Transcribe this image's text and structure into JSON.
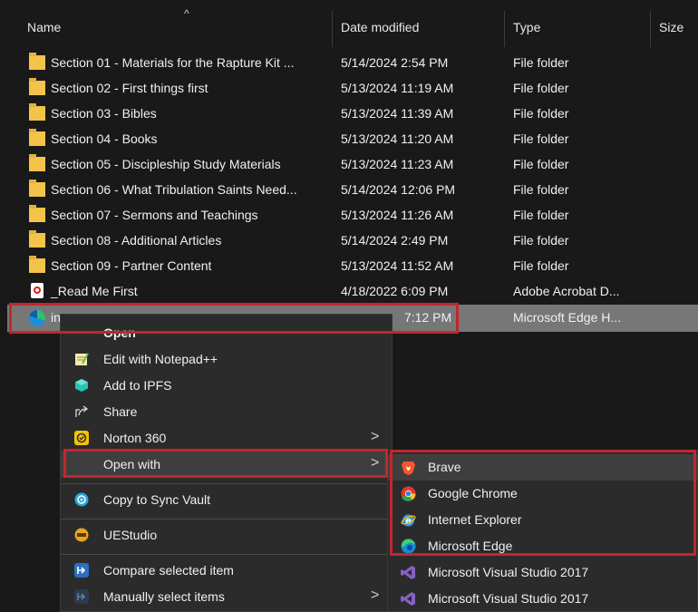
{
  "columns": {
    "name": "Name",
    "date": "Date modified",
    "type": "Type",
    "size": "Size"
  },
  "files": [
    {
      "name": "Section 01 - Materials for the Rapture Kit ...",
      "date": "5/14/2024 2:54 PM",
      "type": "File folder",
      "icon": "folder-icon"
    },
    {
      "name": "Section 02 - First things first",
      "date": "5/13/2024 11:19 AM",
      "type": "File folder",
      "icon": "folder-icon"
    },
    {
      "name": "Section 03 - Bibles",
      "date": "5/13/2024 11:39 AM",
      "type": "File folder",
      "icon": "folder-icon"
    },
    {
      "name": "Section 04 - Books",
      "date": "5/13/2024 11:20 AM",
      "type": "File folder",
      "icon": "folder-icon"
    },
    {
      "name": "Section 05 - Discipleship Study Materials",
      "date": "5/13/2024 11:23 AM",
      "type": "File folder",
      "icon": "folder-icon"
    },
    {
      "name": "Section 06 - What Tribulation Saints Need...",
      "date": "5/14/2024 12:06 PM",
      "type": "File folder",
      "icon": "folder-icon"
    },
    {
      "name": "Section 07 - Sermons and Teachings",
      "date": "5/13/2024 11:26 AM",
      "type": "File folder",
      "icon": "folder-icon"
    },
    {
      "name": "Section 08 - Additional Articles",
      "date": "5/14/2024 2:49 PM",
      "type": "File folder",
      "icon": "folder-icon"
    },
    {
      "name": "Section 09 - Partner Content",
      "date": "5/13/2024 11:52 AM",
      "type": "File folder",
      "icon": "folder-icon"
    },
    {
      "name": "_Read Me First",
      "date": "4/18/2022 6:09 PM",
      "type": "Adobe Acrobat D...",
      "icon": "pdf-icon"
    },
    {
      "name": "in",
      "date": "7:12 PM",
      "type": "Microsoft Edge H...",
      "icon": "edge-icon"
    }
  ],
  "context_menu": {
    "items": [
      {
        "label": "Open",
        "icon": "none"
      },
      {
        "label": "Edit with Notepad++",
        "icon": "notepad-icon"
      },
      {
        "label": "Add to IPFS",
        "icon": "ipfs-cube-icon"
      },
      {
        "label": "Share",
        "icon": "share-icon"
      },
      {
        "label": "Norton 360",
        "icon": "norton-icon"
      },
      {
        "label": "Open with",
        "icon": "none"
      },
      {
        "label": "Copy to Sync Vault",
        "icon": "sync-vault-icon"
      },
      {
        "label": "UEStudio",
        "icon": "uestudio-icon"
      },
      {
        "label": "Compare selected item",
        "icon": "compare-icon"
      },
      {
        "label": "Manually select items",
        "icon": "compare-icon"
      }
    ]
  },
  "open_with_menu": {
    "items": [
      {
        "label": "Brave",
        "icon": "brave-icon"
      },
      {
        "label": "Google Chrome",
        "icon": "chrome-icon"
      },
      {
        "label": "Internet Explorer",
        "icon": "ie-icon"
      },
      {
        "label": "Microsoft Edge",
        "icon": "edge-icon"
      },
      {
        "label": "Microsoft Visual Studio 2017",
        "icon": "visual-studio-icon"
      },
      {
        "label": "Microsoft Visual Studio 2017",
        "icon": "visual-studio-icon"
      }
    ]
  },
  "colors": {
    "background": "#191919",
    "selection": "#777777",
    "menu": "#2b2b2b",
    "highlight_box": "#c0272d",
    "folder": "#f3c34a"
  }
}
